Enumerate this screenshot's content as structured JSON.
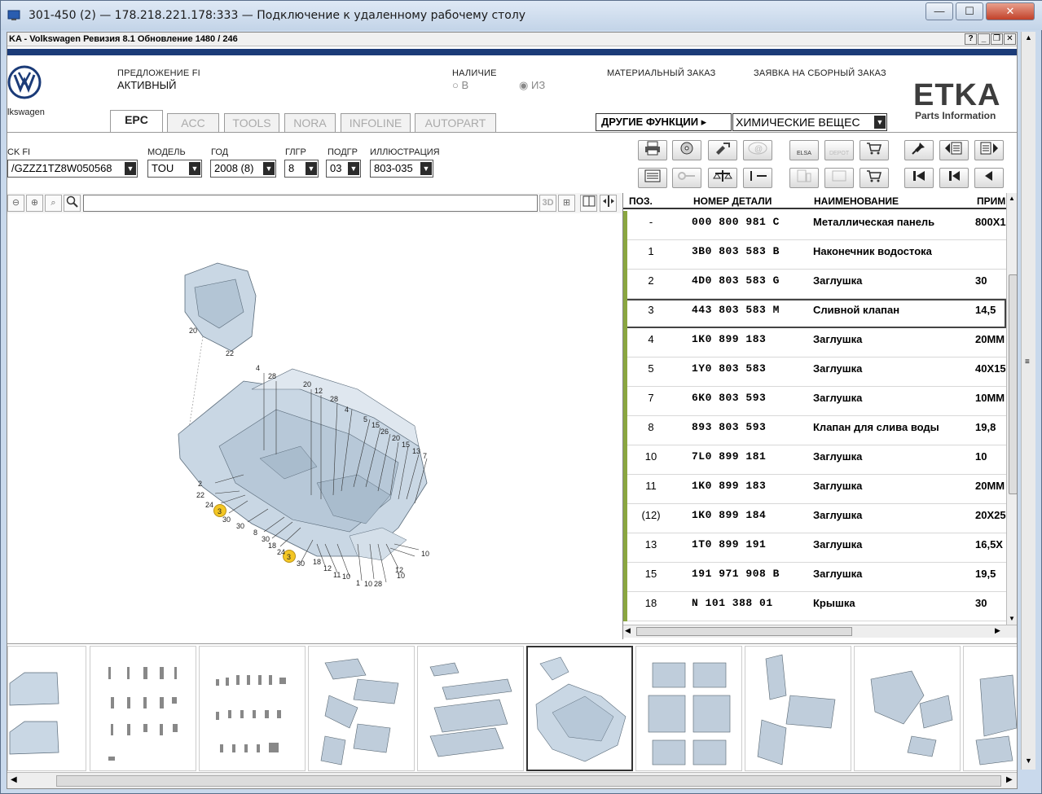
{
  "window": {
    "title": "301-450 (2) — 178.218.221.178:333 — Подключение к удаленному рабочему столу",
    "min": "—",
    "max": "☐",
    "close": "✕"
  },
  "app": {
    "title": "KA - Volkswagen Ревизия 8.1 Обновление 1480 / 246",
    "help": "?",
    "min": "_",
    "restore": "❐",
    "close": "✕"
  },
  "header": {
    "brand_text": "lkswagen",
    "offer_label": "ПРЕДЛОЖЕНИЕ FI",
    "offer_value": "АКТИВНЫЙ",
    "availability_label": "НАЛИЧИЕ",
    "avail_in": "В",
    "avail_from": "ИЗ",
    "material_order": "МАТЕРИАЛЬНЫЙ ЗАКАЗ",
    "assembly_order": "ЗАЯВКА НА СБОРНЫЙ ЗАКАЗ",
    "etka_logo": "ETKA",
    "etka_sub": "Parts Information"
  },
  "tabs": [
    {
      "label": "EPC",
      "active": true
    },
    {
      "label": "ACC",
      "active": false
    },
    {
      "label": "TOOLS",
      "active": false
    },
    {
      "label": "NORA",
      "active": false
    },
    {
      "label": "INFOLINE",
      "active": false
    },
    {
      "label": "AUTOPART",
      "active": false
    }
  ],
  "other_functions": "ДРУГИЕ ФУНКЦИИ ▸",
  "chemicals": "ХИМИЧЕСКИЕ ВЕЩЕС",
  "selectors": {
    "vin_label": "CK FI",
    "vin_value": "/GZZZ1TZ8W050568",
    "model_label": "МОДЕЛЬ",
    "model_value": "TOU",
    "year_label": "ГОД",
    "year_value": "2008 (8)",
    "mg_label": "ГЛГР",
    "mg_value": "8",
    "sg_label": "ПОДГР",
    "sg_value": "03",
    "illus_label": "ИЛЛЮСТРАЦИЯ",
    "illus_value": "803-035"
  },
  "toolbar": {
    "elsa": "ELSA",
    "depot": "DEPOT"
  },
  "zoom": {
    "three_d": "3D"
  },
  "parts_table": {
    "headers": {
      "pos": "ПОЗ.",
      "number": "НОМЕР ДЕТАЛИ",
      "name": "НАИМЕНОВАНИЕ",
      "remark": "ПРИМ"
    },
    "rows": [
      {
        "pos": "-",
        "number": "000 800 981 C",
        "name": "Металлическая панель",
        "remark": "800X1"
      },
      {
        "pos": "1",
        "number": "3B0 803 583 B",
        "name": "Наконечник водостока",
        "remark": ""
      },
      {
        "pos": "2",
        "number": "4D0 803 583 G",
        "name": "Заглушка",
        "remark": "30"
      },
      {
        "pos": "3",
        "number": "443 803 583 M",
        "name": "Сливной клапан",
        "remark": "14,5"
      },
      {
        "pos": "4",
        "number": "1K0 899 183",
        "name": "Заглушка",
        "remark": "20MM"
      },
      {
        "pos": "5",
        "number": "1Y0 803 583",
        "name": "Заглушка",
        "remark": "40X15"
      },
      {
        "pos": "7",
        "number": "6K0 803 593",
        "name": "Заглушка",
        "remark": "10MM"
      },
      {
        "pos": "8",
        "number": "893 803 593",
        "name": "Клапан для слива воды",
        "remark": "19,8"
      },
      {
        "pos": "10",
        "number": "7L0 899 181",
        "name": "Заглушка",
        "remark": "10"
      },
      {
        "pos": "11",
        "number": "1K0 899 183",
        "name": "Заглушка",
        "remark": "20MM"
      },
      {
        "pos": "(12)",
        "number": "1K0 899 184",
        "name": "Заглушка",
        "remark": "20X25"
      },
      {
        "pos": "13",
        "number": "1T0 899 191",
        "name": "Заглушка",
        "remark": "16,5X"
      },
      {
        "pos": "15",
        "number": "191 971 908 B",
        "name": "Заглушка",
        "remark": "19,5"
      },
      {
        "pos": "18",
        "number": "N   101 388 01",
        "name": "Крышка",
        "remark": "30"
      }
    ],
    "selected_index": 3
  },
  "illustration": {
    "callouts": [
      "20",
      "22",
      "4",
      "28",
      "20",
      "12",
      "28",
      "4",
      "5",
      "15",
      "26",
      "20",
      "15",
      "13",
      "7",
      "2",
      "22",
      "24",
      "30",
      "30",
      "8",
      "30",
      "18",
      "24",
      "30",
      "18",
      "12",
      "11",
      "10",
      "1",
      "10",
      "28",
      "12",
      "10",
      "10",
      "3",
      "3"
    ]
  },
  "colors": {
    "accent": "#1b3b78",
    "row_marker": "#8aa640",
    "highlight": "#f3c623"
  }
}
